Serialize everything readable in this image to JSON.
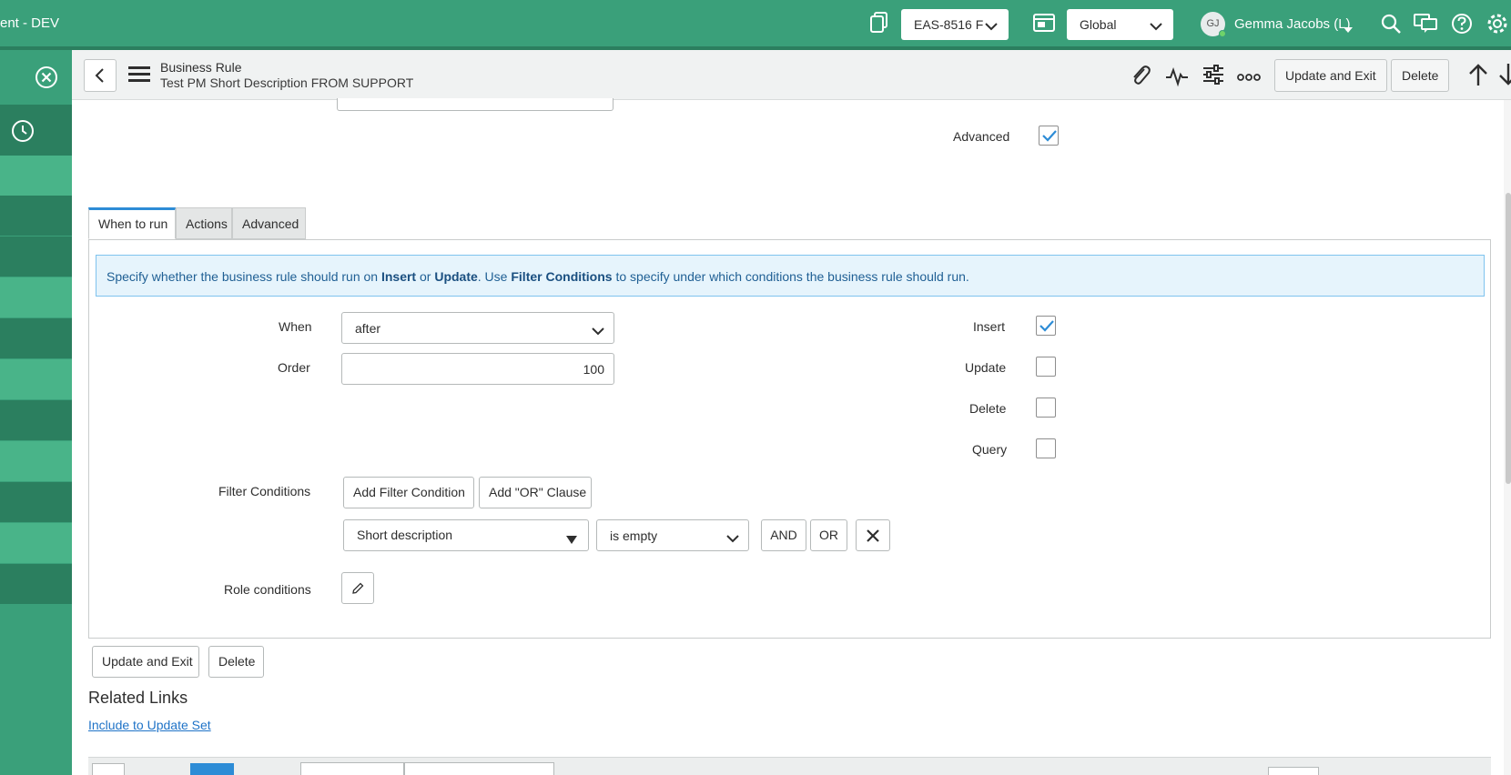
{
  "banner": {
    "app_title": "ent - DEV",
    "update_set": "EAS-8516 F",
    "scope": "Global",
    "user_initials": "GJ",
    "user_name": "Gemma Jacobs (L)"
  },
  "formbar": {
    "record_type": "Business Rule",
    "record_name": "Test PM Short Description FROM SUPPORT",
    "update_exit_label": "Update and Exit",
    "delete_label": "Delete"
  },
  "fields": {
    "advanced_label": "Advanced",
    "advanced_checked": true
  },
  "tabs": [
    {
      "label": "When to run",
      "active": true
    },
    {
      "label": "Actions",
      "active": false
    },
    {
      "label": "Advanced",
      "active": false
    }
  ],
  "when_to_run": {
    "info": {
      "part1": "Specify whether the business rule should run on ",
      "insert": "Insert",
      "or": " or ",
      "update": "Update",
      "part2": ". Use ",
      "filter_conditions": "Filter Conditions",
      "part3": " to specify under which conditions the business rule should run."
    },
    "when_label": "When",
    "when_value": "after",
    "order_label": "Order",
    "order_value": "100",
    "insert_label": "Insert",
    "insert_checked": true,
    "update_label": "Update",
    "update_checked": false,
    "delete_label": "Delete",
    "delete_checked": false,
    "query_label": "Query",
    "query_checked": false,
    "filter_label": "Filter Conditions",
    "add_filter_label": "Add Filter Condition",
    "add_or_label": "Add \"OR\" Clause",
    "condition_field": "Short description",
    "condition_operator": "is empty",
    "and_label": "AND",
    "or_label": "OR",
    "role_conditions_label": "Role conditions"
  },
  "footer": {
    "update_exit_label": "Update and Exit",
    "delete_label": "Delete",
    "related_links_title": "Related Links",
    "include_update_set_link": "Include to Update Set"
  },
  "colors": {
    "banner": "#3aa07a",
    "banner_dark": "#2b7f5f",
    "accent_blue": "#2d8cd6",
    "check_blue": "#2d8cd6"
  }
}
